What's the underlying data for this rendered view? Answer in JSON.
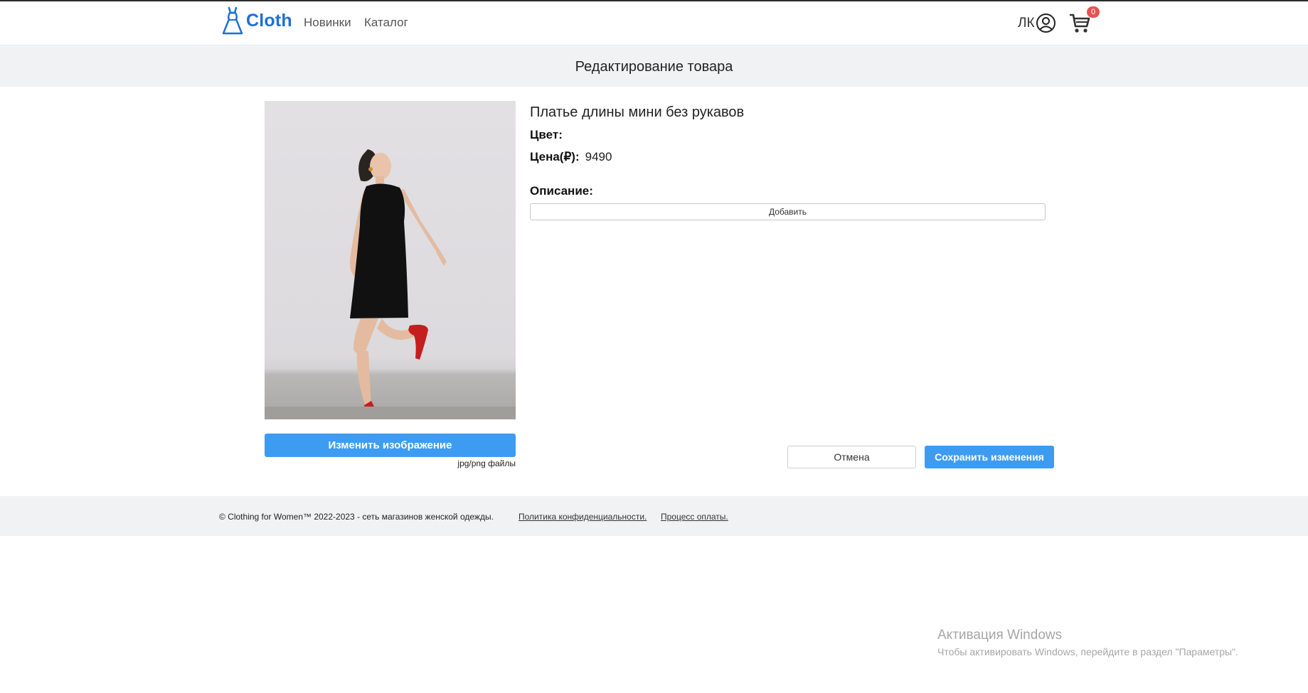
{
  "brand": {
    "name": "Cloth",
    "color": "#1f6fd6",
    "logo_icon": "dress-icon"
  },
  "nav": {
    "items": [
      {
        "label": "Новинки"
      },
      {
        "label": "Каталог"
      }
    ]
  },
  "account": {
    "label": "ЛК",
    "icon": "user-circle-icon"
  },
  "cart": {
    "count": "0",
    "icon": "cart-icon",
    "badge_color": "#e55353"
  },
  "page": {
    "title": "Редактирование товара"
  },
  "product": {
    "name": "Платье длины мини без рукавов",
    "color_label": "Цвет:",
    "price_label": "Цена(₽):",
    "price": "9490",
    "description_label": "Описание:",
    "add_description_label": "Добавить"
  },
  "image_controls": {
    "change_label": "Изменить изображение",
    "hint": "jpg/png файлы"
  },
  "actions": {
    "cancel_label": "Отмена",
    "save_label": "Сохранить изменения",
    "primary_color": "#3d9cf2"
  },
  "footer": {
    "copyright": "© Clothing for Women™ 2022-2023 - сеть магазинов женской одежды.",
    "links": [
      {
        "label": "Политика конфиденциальности."
      },
      {
        "label": "Процесс оплаты."
      }
    ]
  },
  "windows_activation": {
    "title": "Активация Windows",
    "subtitle": "Чтобы активировать Windows, перейдите в раздел \"Параметры\"."
  }
}
